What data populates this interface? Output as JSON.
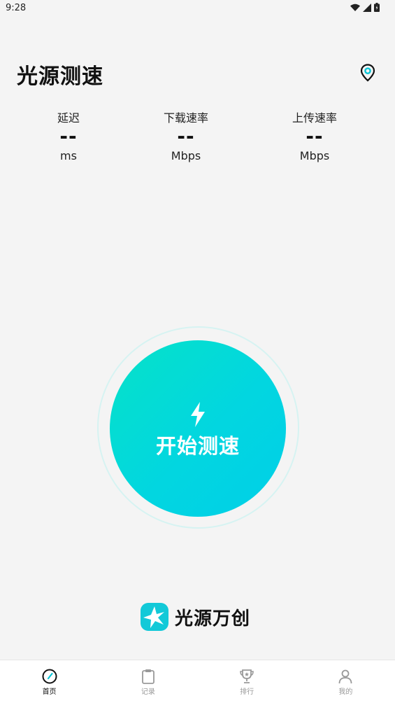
{
  "status_bar": {
    "time": "9:28"
  },
  "header": {
    "title": "光源测速"
  },
  "metrics": [
    {
      "label": "延迟",
      "value": "--",
      "unit": "ms"
    },
    {
      "label": "下载速率",
      "value": "--",
      "unit": "Mbps"
    },
    {
      "label": "上传速率",
      "value": "--",
      "unit": "Mbps"
    }
  ],
  "start_button": {
    "label": "开始测速"
  },
  "brand": {
    "name": "光源万创"
  },
  "nav": {
    "items": [
      {
        "label": "首页",
        "icon": "speedometer-icon",
        "active": true
      },
      {
        "label": "记录",
        "icon": "clipboard-icon",
        "active": false
      },
      {
        "label": "排行",
        "icon": "trophy-icon",
        "active": false
      },
      {
        "label": "我的",
        "icon": "person-icon",
        "active": false
      }
    ]
  },
  "colors": {
    "accent": "#00d8dc",
    "accent_start": "#06e2c8",
    "nav_inactive": "#999999"
  }
}
